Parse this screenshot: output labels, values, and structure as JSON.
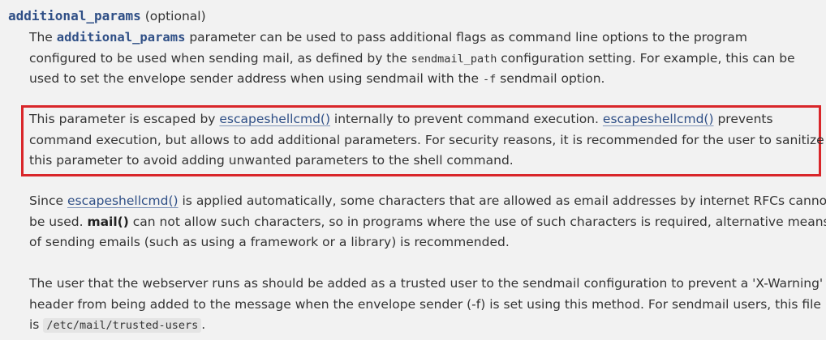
{
  "term": {
    "name": "additional_params",
    "optional": "(optional)"
  },
  "para1": {
    "l1_a": "The ",
    "l1_code": "additional_params",
    "l1_b": " parameter can be used to pass additional flags as command line options to the program",
    "l2_a": "configured to be used when sending mail, as defined by the ",
    "l2_code": "sendmail_path",
    "l2_b": " configuration setting. For example, this can be",
    "l3_a": "used to set the envelope sender address when using sendmail with the ",
    "l3_code": "-f",
    "l3_b": " sendmail option."
  },
  "para2": {
    "l1_a": "This parameter is escaped by ",
    "l1_link1": "escapeshellcmd()",
    "l1_b": " internally to prevent command execution. ",
    "l1_link2": "escapeshellcmd()",
    "l1_c": " prevents",
    "l2": "command execution, but allows to add additional parameters. For security reasons, it is recommended for the user to sanitize",
    "l3": "this parameter to avoid adding unwanted parameters to the shell command."
  },
  "para3": {
    "l1_a": "Since ",
    "l1_link": "escapeshellcmd()",
    "l1_b": " is applied automatically, some characters that are allowed as email addresses by internet RFCs cannot",
    "l2_a": "be used. ",
    "l2_bold": "mail()",
    "l2_b": " can not allow such characters, so in programs where the use of such characters is required, alternative means",
    "l3": "of sending emails (such as using a framework or a library) is recommended."
  },
  "para4": {
    "l1": "The user that the webserver runs as should be added as a trusted user to the sendmail configuration to prevent a 'X-Warning'",
    "l2": "header from being added to the message when the envelope sender (-f) is set using this method. For sendmail users, this file",
    "l3_a": "is ",
    "l3_code": "/etc/mail/trusted-users",
    "l3_b": "."
  },
  "colors": {
    "link": "#2f4f86",
    "highlight_border": "#d9262a",
    "background": "#f2f2f2"
  }
}
